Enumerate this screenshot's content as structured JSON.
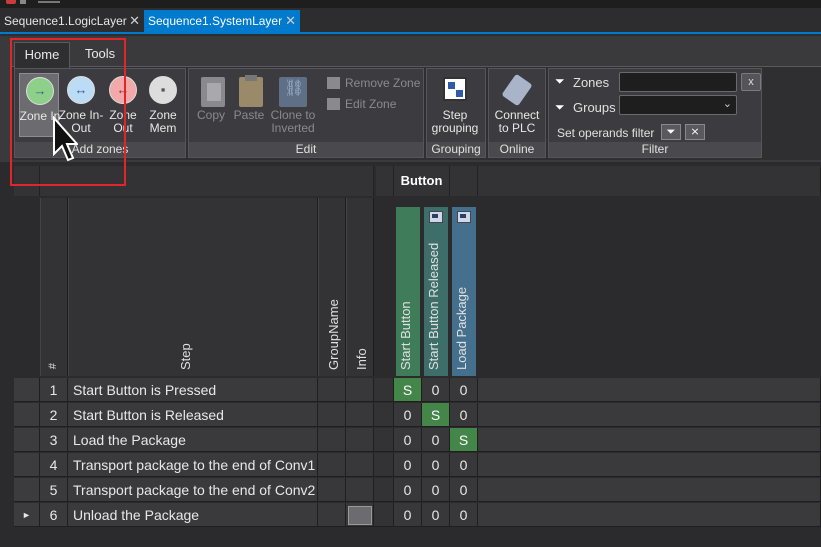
{
  "window": {
    "tabs": [
      {
        "label": "Sequence1.LogicLayer",
        "close": "✕"
      },
      {
        "label": "Sequence1.SystemLayer",
        "close": "✕"
      }
    ]
  },
  "ribbon": {
    "tabs": [
      "Home",
      "Tools"
    ],
    "groups": {
      "add_zones": {
        "label": "Add zones",
        "buttons": [
          {
            "label": "Zone In",
            "color": "#8ed08a"
          },
          {
            "label": "Zone In-Out",
            "color": "#bcdcf5"
          },
          {
            "label": "Zone Out",
            "color": "#f1a9a9"
          },
          {
            "label": "Zone Mem",
            "color": "#dddddd"
          }
        ]
      },
      "edit": {
        "label": "Edit",
        "copy": "Copy",
        "paste": "Paste",
        "clone": "Clone to Inverted",
        "remove_zone": "Remove Zone",
        "edit_zone": "Edit Zone"
      },
      "grouping": {
        "label": "Grouping",
        "step_grouping": "Step grouping"
      },
      "online": {
        "label": "Online",
        "connect": "Connect to PLC"
      },
      "filter": {
        "label": "Filter",
        "zones_label": "Zones",
        "zones_value": "",
        "clear": "x",
        "groups_label": "Groups",
        "groups_value": "",
        "set_operands": "Set operands filter"
      }
    }
  },
  "grid": {
    "group_header": "Button",
    "columns": {
      "num": "#",
      "step": "Step",
      "group_name": "GroupName",
      "info": "Info"
    },
    "signals": [
      {
        "name": "Start Button",
        "color": "#3f7d5a"
      },
      {
        "name": "Start Button Released",
        "color": "#3d6e6a"
      },
      {
        "name": "Load Package",
        "color": "#44708e"
      }
    ],
    "rows": [
      {
        "num": "1",
        "step": "Start Button is Pressed",
        "values": [
          "S",
          "0",
          "0"
        ],
        "marker": ""
      },
      {
        "num": "2",
        "step": "Start Button is Released",
        "values": [
          "0",
          "S",
          "0"
        ],
        "marker": ""
      },
      {
        "num": "3",
        "step": "Load the Package",
        "values": [
          "0",
          "0",
          "S"
        ],
        "marker": ""
      },
      {
        "num": "4",
        "step": "Transport package to the end of Conv1",
        "values": [
          "0",
          "0",
          "0"
        ],
        "marker": ""
      },
      {
        "num": "5",
        "step": "Transport package to the end of Conv2",
        "values": [
          "0",
          "0",
          "0"
        ],
        "marker": ""
      },
      {
        "num": "6",
        "step": "Unload the Package",
        "values": [
          "0",
          "0",
          "0"
        ],
        "marker": "►"
      }
    ]
  }
}
